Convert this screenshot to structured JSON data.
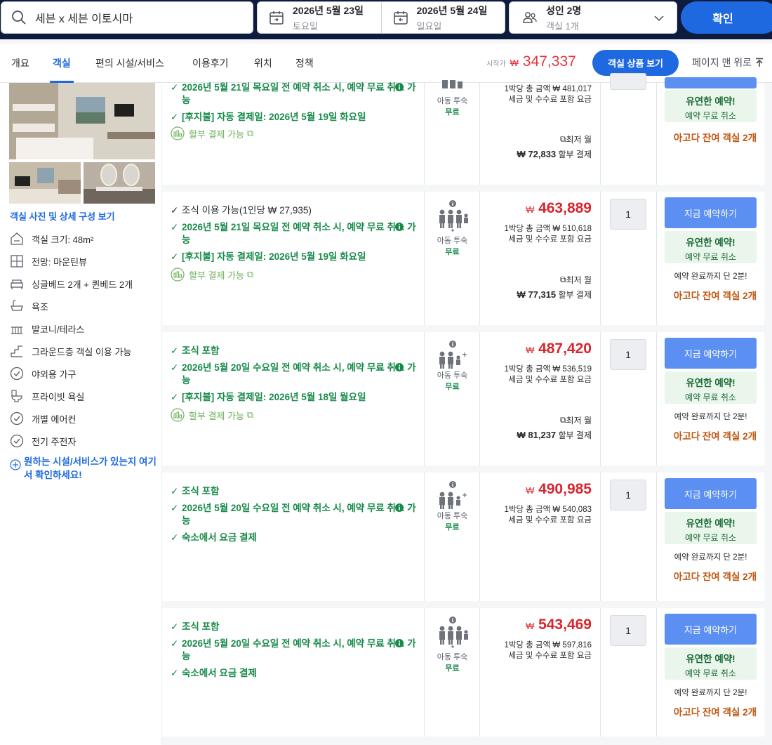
{
  "search": {
    "destination": "세븐 x 세븐 이토시마",
    "checkin": {
      "date": "2026년 5월 23일",
      "weekday": "토요일"
    },
    "checkout": {
      "date": "2026년 5월 24일",
      "weekday": "일요일"
    },
    "occupancy": {
      "guests": "성인 2명",
      "rooms": "객실 1개"
    },
    "confirm_label": "확인"
  },
  "tabs": [
    "개요",
    "객실",
    "편의 시설/서비스",
    "이용후기",
    "위치",
    "정책"
  ],
  "active_tab": "객실",
  "price_from": {
    "label": "시작가",
    "currency": "₩",
    "value": "347,337"
  },
  "view_rooms_label": "객실 상품 보기",
  "to_top_label": "페이지 맨 위로",
  "room": {
    "details_link": "객실 사진 및 상세 구성 보기",
    "features": [
      {
        "icon": "room-size-icon",
        "label": "객실 크기: 48m²"
      },
      {
        "icon": "view-icon",
        "label": "전망: 마운틴뷰"
      },
      {
        "icon": "bed-icon",
        "label": "싱글베드 2개 + 퀸베드 2개"
      },
      {
        "icon": "bathtub-icon",
        "label": "욕조"
      },
      {
        "icon": "balcony-icon",
        "label": "발코니/테라스"
      },
      {
        "icon": "stairs-icon",
        "label": "그라운드층 객실 이용 가능"
      },
      {
        "icon": "check-circle-icon",
        "label": "야외용 가구"
      },
      {
        "icon": "toilet-icon",
        "label": "프라이빗 욕실"
      },
      {
        "icon": "check-circle-icon",
        "label": "개별 에어컨"
      },
      {
        "icon": "check-circle-icon",
        "label": "전기 주전자"
      }
    ],
    "more_link": "원하는 시설/서비스가 있는지 여기서 확인하세요!"
  },
  "common": {
    "child_text": "아동 투숙",
    "child_free": "무료",
    "per_night": "1박당 총 금액",
    "tax_note": "세금 및 수수료 포함 요금",
    "min_monthly": "최저 월",
    "installment_suffix": "할부 결제",
    "installment_label": "할부 결제 가능",
    "book_label": "지금 예약하기",
    "flex_title": "유연한 예약!",
    "flex_sub": "예약 무료 취소",
    "rush": "예약 완료까지 단 2분!",
    "remain": "아고다 잔여 객실 2개"
  },
  "offers": [
    {
      "benefits": [
        {
          "type": "green",
          "text": "2026년 5월 21일 목요일 전 예약 취소 시, 예약 무료 취소 가능",
          "info": true
        },
        {
          "type": "green",
          "text": "[후지불] 자동 결제일: 2026년 5월 19일 화요일"
        }
      ],
      "installment": true,
      "per_night_total": "₩ 481,017",
      "price": "",
      "monthly": "72,833",
      "qty": "",
      "book": false,
      "rush": false
    },
    {
      "benefits": [
        {
          "type": "black",
          "text": "조식 이용 가능(1인당 ₩ 27,935)"
        },
        {
          "type": "green",
          "text": "2026년 5월 21일 목요일 전 예약 취소 시, 예약 무료 취소 가능",
          "info": true
        },
        {
          "type": "green",
          "text": "[후지불] 자동 결제일: 2026년 5월 19일 화요일"
        }
      ],
      "installment": true,
      "per_night_total": "₩ 510,618",
      "price": "463,889",
      "monthly": "77,315",
      "qty": "1",
      "book": true,
      "rush": true
    },
    {
      "benefits": [
        {
          "type": "green",
          "text": "조식 포함"
        },
        {
          "type": "green",
          "text": "2026년 5월 20일 수요일 전 예약 취소 시, 예약 무료 취소 가능",
          "info": true
        },
        {
          "type": "green",
          "text": "[후지불] 자동 결제일: 2026년 5월 18일 월요일"
        }
      ],
      "installment": true,
      "per_night_total": "₩ 536,519",
      "price": "487,420",
      "monthly": "81,237",
      "qty": "1",
      "book": true,
      "rush": true
    },
    {
      "benefits": [
        {
          "type": "green",
          "text": "조식 포함"
        },
        {
          "type": "green",
          "text": "2026년 5월 20일 수요일 전 예약 취소 시, 예약 무료 취소 가능",
          "info": true
        },
        {
          "type": "green",
          "text": "숙소에서 요금 결제"
        }
      ],
      "installment": false,
      "per_night_total": "₩ 540,083",
      "price": "490,985",
      "monthly": "",
      "qty": "1",
      "book": true,
      "rush": true
    },
    {
      "benefits": [
        {
          "type": "green",
          "text": "조식 포함"
        },
        {
          "type": "green",
          "text": "2026년 5월 20일 수요일 전 예약 취소 시, 예약 무료 취소 가능",
          "info": true
        },
        {
          "type": "green",
          "text": "숙소에서 요금 결제"
        }
      ],
      "installment": false,
      "per_night_total": "₩ 597,816",
      "price": "543,469",
      "monthly": "",
      "qty": "1",
      "book": true,
      "rush": true
    }
  ],
  "colors": {
    "brand_blue": "#1e69e0",
    "price_red": "#d8262e",
    "green": "#178a4a",
    "remain_orange": "#c0530d"
  }
}
